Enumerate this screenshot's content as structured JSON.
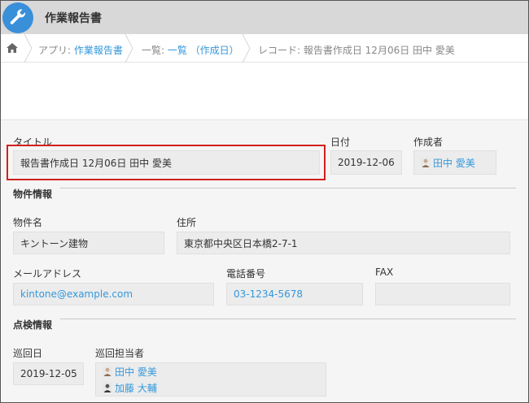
{
  "app": {
    "title": "作業報告書"
  },
  "breadcrumb": {
    "app_prefix": "アプリ: ",
    "app_link": "作業報告書",
    "list_prefix": "一覧: ",
    "list_link": "一覧 （作成日）",
    "record_text": "レコード: 報告書作成日 12月06日 田中 愛美"
  },
  "fields": {
    "title_label": "タイトル",
    "title_value": "報告書作成日 12月06日 田中 愛美",
    "date_label": "日付",
    "date_value": "2019-12-06",
    "creator_label": "作成者",
    "creator_value": "田中 愛美"
  },
  "property_section": {
    "heading": "物件情報",
    "name_label": "物件名",
    "name_value": "キントーン建物",
    "address_label": "住所",
    "address_value": "東京都中央区日本橋2-7-1",
    "email_label": "メールアドレス",
    "email_value": "kintone@example.com",
    "phone_label": "電話番号",
    "phone_value": "03-1234-5678",
    "fax_label": "FAX",
    "fax_value": ""
  },
  "inspection_section": {
    "heading": "点検情報",
    "patrol_date_label": "巡回日",
    "patrol_date_value": "2019-12-05",
    "staff_label": "巡回担当者",
    "staff": [
      "田中 愛美",
      "加藤 大輔"
    ]
  },
  "colors": {
    "link": "#3498db",
    "highlight": "#d0211c",
    "app_icon": "#3a8fd9"
  },
  "icons": {
    "app": "wrench-icon",
    "home": "home-icon",
    "user": "user-avatar-icon"
  }
}
